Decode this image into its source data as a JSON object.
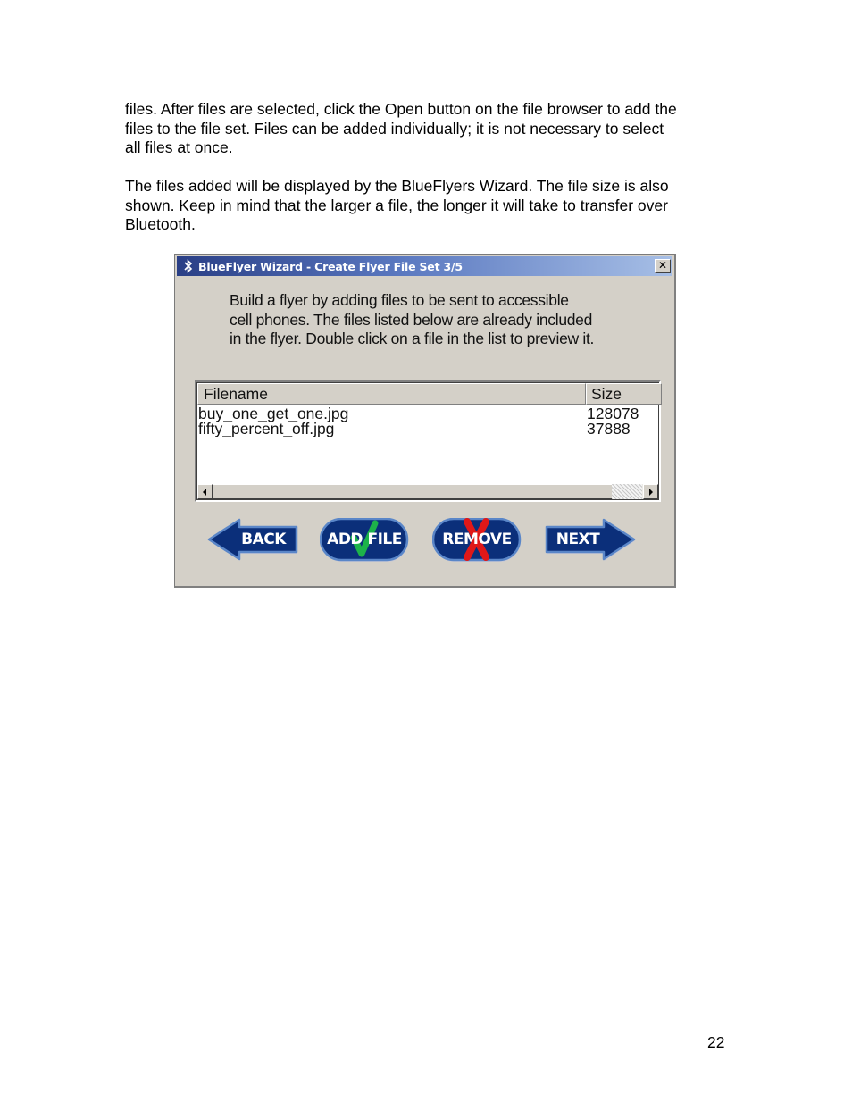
{
  "document": {
    "paragraph1": [
      "files.  After files are selected, click the Open button on the file browser to add the",
      "files to the file set.  Files can be added individually; it is not necessary to select",
      "all files at once."
    ],
    "paragraph2": [
      "The files added will be displayed by the BlueFlyers Wizard.  The file size is also",
      "shown.  Keep in mind that the larger a file, the longer it will take to transfer over",
      "Bluetooth."
    ],
    "page_number": "22"
  },
  "dialog": {
    "title": "BlueFlyer Wizard - Create Flyer File Set 3/5",
    "close_glyph": "✕",
    "instructions": [
      "Build a flyer by adding files to be sent to accessible",
      "cell phones. The files listed below are already included",
      "in the flyer. Double click on a file in the list to preview it."
    ],
    "file_list": {
      "columns": [
        "Filename",
        "Size"
      ],
      "rows": [
        {
          "filename": "buy_one_get_one.jpg",
          "size": "128078"
        },
        {
          "filename": "fifty_percent_off.jpg",
          "size": "37888"
        }
      ]
    },
    "buttons": {
      "back": "BACK",
      "add_file": "ADD FILE",
      "remove": "REMOVE",
      "next": "NEXT"
    },
    "colors": {
      "button_fill": "#0b2f7a",
      "button_border": "#5a86c8",
      "check_green": "#1db34a",
      "remove_red": "#e01818"
    },
    "icons": [
      "bluetooth-icon",
      "close-icon",
      "scroll-left-arrow-icon",
      "scroll-right-arrow-icon",
      "checkmark-icon",
      "red-x-icon"
    ]
  }
}
